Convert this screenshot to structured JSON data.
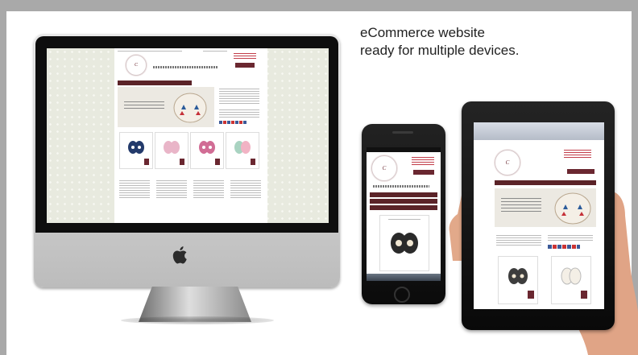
{
  "headline": {
    "line1": "eCommerce website",
    "line2": "ready for multiple devices."
  },
  "colors": {
    "brand": "#5b2328",
    "background": "#ffffff",
    "frame": "#a9a9a9"
  },
  "icons": [
    "apple-logo-icon"
  ]
}
